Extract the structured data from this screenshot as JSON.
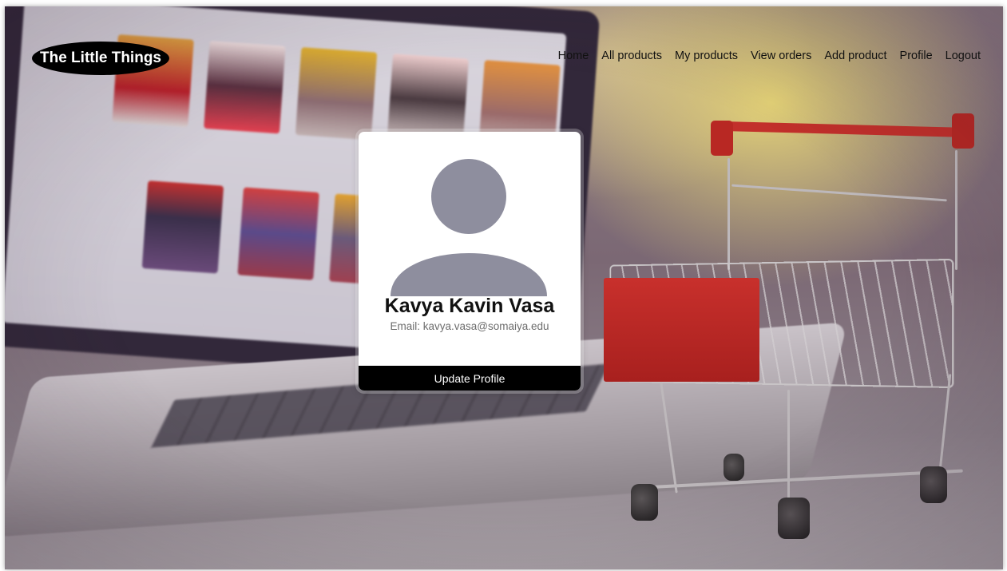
{
  "header": {
    "brand": "The Little Things",
    "nav": [
      {
        "label": "Home"
      },
      {
        "label": "All products"
      },
      {
        "label": "My products"
      },
      {
        "label": "View orders"
      },
      {
        "label": "Add product"
      },
      {
        "label": "Profile"
      },
      {
        "label": "Logout"
      }
    ]
  },
  "profile": {
    "name": "Kavya Kavin Vasa",
    "email_label": "Email:",
    "email": "kavya.vasa@somaiya.edu",
    "avatar_icon": "user-avatar-icon",
    "avatar_color": "#8e8e9e",
    "update_button": "Update Profile"
  },
  "background": {
    "description_icon": "shopping-cart-laptop-photo"
  },
  "colors": {
    "accent": "#000000",
    "cart_red": "#c2302b"
  }
}
